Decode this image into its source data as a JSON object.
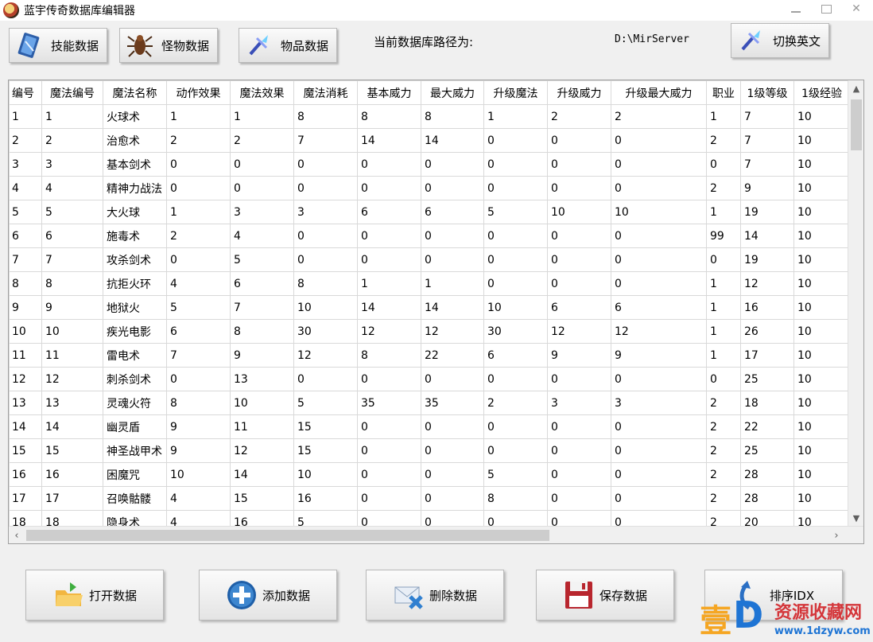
{
  "window": {
    "title": "蓝宇传奇数据库编辑器",
    "controls": [
      "minimize-icon",
      "maximize-icon",
      "close-icon"
    ],
    "close_glyph": "✕"
  },
  "toolbar": {
    "skill_label": "技能数据",
    "monster_label": "怪物数据",
    "item_label": "物品数据",
    "switch_label": "切换英文",
    "path_label": "当前数据库路径为:",
    "path_value": "D:\\MirServer"
  },
  "grid": {
    "columns": [
      "编号",
      "魔法编号",
      "魔法名称",
      "动作效果",
      "魔法效果",
      "魔法消耗",
      "基本威力",
      "最大威力",
      "升级魔法",
      "升级威力",
      "升级最大威力",
      "职业",
      "1级等级",
      "1级经验"
    ],
    "rows": [
      [
        "1",
        "1",
        "火球术",
        "1",
        "1",
        "8",
        "8",
        "8",
        "1",
        "2",
        "2",
        "1",
        "7",
        "10"
      ],
      [
        "2",
        "2",
        "治愈术",
        "2",
        "2",
        "7",
        "14",
        "14",
        "0",
        "0",
        "0",
        "2",
        "7",
        "10"
      ],
      [
        "3",
        "3",
        "基本剑术",
        "0",
        "0",
        "0",
        "0",
        "0",
        "0",
        "0",
        "0",
        "0",
        "7",
        "10"
      ],
      [
        "4",
        "4",
        "精神力战法",
        "0",
        "0",
        "0",
        "0",
        "0",
        "0",
        "0",
        "0",
        "2",
        "9",
        "10"
      ],
      [
        "5",
        "5",
        "大火球",
        "1",
        "3",
        "3",
        "6",
        "6",
        "5",
        "10",
        "10",
        "1",
        "19",
        "10"
      ],
      [
        "6",
        "6",
        "施毒术",
        "2",
        "4",
        "0",
        "0",
        "0",
        "0",
        "0",
        "0",
        "99",
        "14",
        "10"
      ],
      [
        "7",
        "7",
        "攻杀剑术",
        "0",
        "5",
        "0",
        "0",
        "0",
        "0",
        "0",
        "0",
        "0",
        "19",
        "10"
      ],
      [
        "8",
        "8",
        "抗拒火环",
        "4",
        "6",
        "8",
        "1",
        "1",
        "0",
        "0",
        "0",
        "1",
        "12",
        "10"
      ],
      [
        "9",
        "9",
        "地狱火",
        "5",
        "7",
        "10",
        "14",
        "14",
        "10",
        "6",
        "6",
        "1",
        "16",
        "10"
      ],
      [
        "10",
        "10",
        "疾光电影",
        "6",
        "8",
        "30",
        "12",
        "12",
        "30",
        "12",
        "12",
        "1",
        "26",
        "10"
      ],
      [
        "11",
        "11",
        "雷电术",
        "7",
        "9",
        "12",
        "8",
        "22",
        "6",
        "9",
        "9",
        "1",
        "17",
        "10"
      ],
      [
        "12",
        "12",
        "刺杀剑术",
        "0",
        "13",
        "0",
        "0",
        "0",
        "0",
        "0",
        "0",
        "0",
        "25",
        "10"
      ],
      [
        "13",
        "13",
        "灵魂火符",
        "8",
        "10",
        "5",
        "35",
        "35",
        "2",
        "3",
        "3",
        "2",
        "18",
        "10"
      ],
      [
        "14",
        "14",
        "幽灵盾",
        "9",
        "11",
        "15",
        "0",
        "0",
        "0",
        "0",
        "0",
        "2",
        "22",
        "10"
      ],
      [
        "15",
        "15",
        "神圣战甲术",
        "9",
        "12",
        "15",
        "0",
        "0",
        "0",
        "0",
        "0",
        "2",
        "25",
        "10"
      ],
      [
        "16",
        "16",
        "困魔咒",
        "10",
        "14",
        "10",
        "0",
        "0",
        "5",
        "0",
        "0",
        "2",
        "28",
        "10"
      ],
      [
        "17",
        "17",
        "召唤骷髅",
        "4",
        "15",
        "16",
        "0",
        "0",
        "8",
        "0",
        "0",
        "2",
        "28",
        "10"
      ],
      [
        "18",
        "18",
        "隐身术",
        "4",
        "16",
        "5",
        "0",
        "0",
        "0",
        "0",
        "0",
        "2",
        "20",
        "10"
      ]
    ]
  },
  "footer": {
    "open_label": "打开数据",
    "add_label": "添加数据",
    "delete_label": "删除数据",
    "save_label": "保存数据",
    "sort_label": "排序IDX"
  },
  "watermark": {
    "glyph1": "壹",
    "glyph2": "D",
    "text": "资源收藏网",
    "url": "www.1dzyw.com"
  }
}
